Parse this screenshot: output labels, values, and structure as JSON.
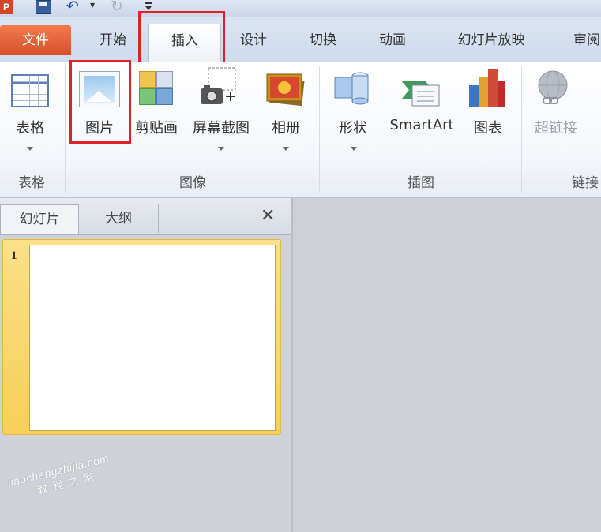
{
  "qat": {
    "app_logo": "P"
  },
  "tabs": [
    {
      "label": "文件"
    },
    {
      "label": "开始"
    },
    {
      "label": "插入"
    },
    {
      "label": "设计"
    },
    {
      "label": "切换"
    },
    {
      "label": "动画"
    },
    {
      "label": "幻灯片放映"
    },
    {
      "label": "审阅"
    }
  ],
  "ribbon": {
    "groups": {
      "tables": "表格",
      "images": "图像",
      "illustrations": "插图",
      "links": "链接"
    },
    "buttons": {
      "table": "表格",
      "picture": "图片",
      "clipart": "剪贴画",
      "screenshot": "屏幕截图",
      "album": "相册",
      "shapes": "形状",
      "smartart": "SmartArt",
      "chart": "图表",
      "hyperlink": "超链接"
    }
  },
  "panel": {
    "tabs": [
      {
        "label": "幻灯片"
      },
      {
        "label": "大纲"
      }
    ],
    "close": "✕",
    "slide_number": "1"
  },
  "watermark": {
    "line1": "jiaochengzhijia.com",
    "line2": "教程之家"
  },
  "colors": {
    "file_tab": "#d4512a",
    "highlight": "#e3202a",
    "slide_selected": "#f6cf57"
  },
  "icons": [
    "save-icon",
    "undo-icon",
    "redo-icon",
    "customize-icon",
    "table-icon",
    "picture-icon",
    "clipart-icon",
    "screenshot-icon",
    "album-icon",
    "shapes-icon",
    "smartart-icon",
    "chart-icon",
    "hyperlink-icon",
    "close-icon"
  ]
}
